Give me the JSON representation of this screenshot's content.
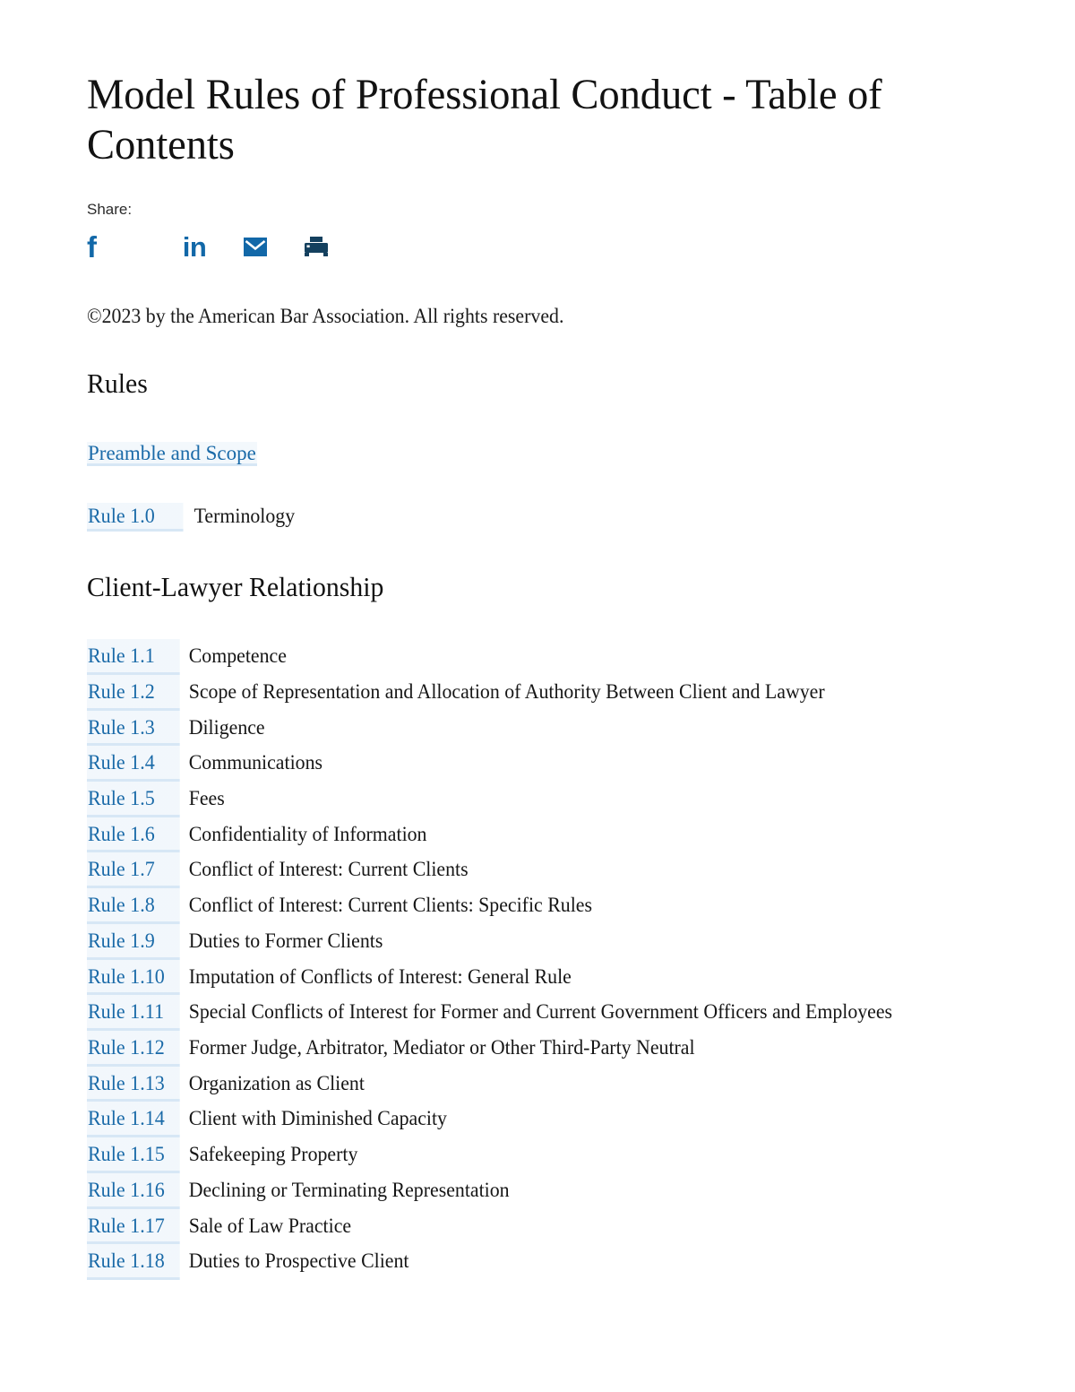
{
  "document": {
    "title": "Model Rules of Professional Conduct - Table of Contents",
    "copyright": "©2023 by the American Bar Association. All rights reserved."
  },
  "share": {
    "label": "Share:",
    "icons": [
      {
        "name": "facebook-icon",
        "glyph": "f",
        "color": "#1268a8"
      },
      {
        "name": "linkedin-icon",
        "glyph": "in",
        "color": "#1268a8"
      },
      {
        "name": "email-icon",
        "glyph": "envelope",
        "color": "#1268a8"
      },
      {
        "name": "print-icon",
        "glyph": "printer",
        "color": "#14405e"
      }
    ]
  },
  "sections": [
    {
      "heading": "Rules",
      "preamble_link": "Preamble and Scope",
      "standalone_rule": {
        "number": "Rule 1.0",
        "title": "Terminology"
      }
    },
    {
      "heading": "Client-Lawyer Relationship",
      "rules": [
        {
          "number": "Rule 1.1",
          "title": "Competence"
        },
        {
          "number": "Rule 1.2",
          "title": "Scope of Representation and Allocation of Authority Between Client and Lawyer"
        },
        {
          "number": "Rule 1.3",
          "title": "Diligence"
        },
        {
          "number": "Rule 1.4",
          "title": "Communications"
        },
        {
          "number": "Rule 1.5",
          "title": "Fees"
        },
        {
          "number": "Rule 1.6",
          "title": "Confidentiality of Information"
        },
        {
          "number": "Rule 1.7",
          "title": "Conflict of Interest: Current Clients"
        },
        {
          "number": "Rule 1.8",
          "title": "Conflict of Interest: Current Clients: Specific Rules"
        },
        {
          "number": "Rule 1.9",
          "title": "Duties to Former Clients"
        },
        {
          "number": "Rule 1.10",
          "title": "Imputation of Conflicts of Interest: General Rule"
        },
        {
          "number": "Rule 1.11",
          "title": "Special Conflicts of Interest for Former and Current Government Officers and Employees"
        },
        {
          "number": "Rule 1.12",
          "title": "Former Judge, Arbitrator, Mediator or Other Third-Party Neutral"
        },
        {
          "number": "Rule 1.13",
          "title": "Organization as Client"
        },
        {
          "number": "Rule 1.14",
          "title": "Client with Diminished Capacity"
        },
        {
          "number": "Rule 1.15",
          "title": "Safekeeping Property"
        },
        {
          "number": "Rule 1.16",
          "title": "Declining or Terminating Representation"
        },
        {
          "number": "Rule 1.17",
          "title": "Sale of Law Practice"
        },
        {
          "number": "Rule 1.18",
          "title": "Duties to Prospective Client"
        }
      ]
    }
  ],
  "colors": {
    "link": "#1a6aa8",
    "link_highlight": "#d7e7f5",
    "social_blue": "#1268a8",
    "print_navy": "#14405e",
    "text": "#1a1a1a"
  }
}
